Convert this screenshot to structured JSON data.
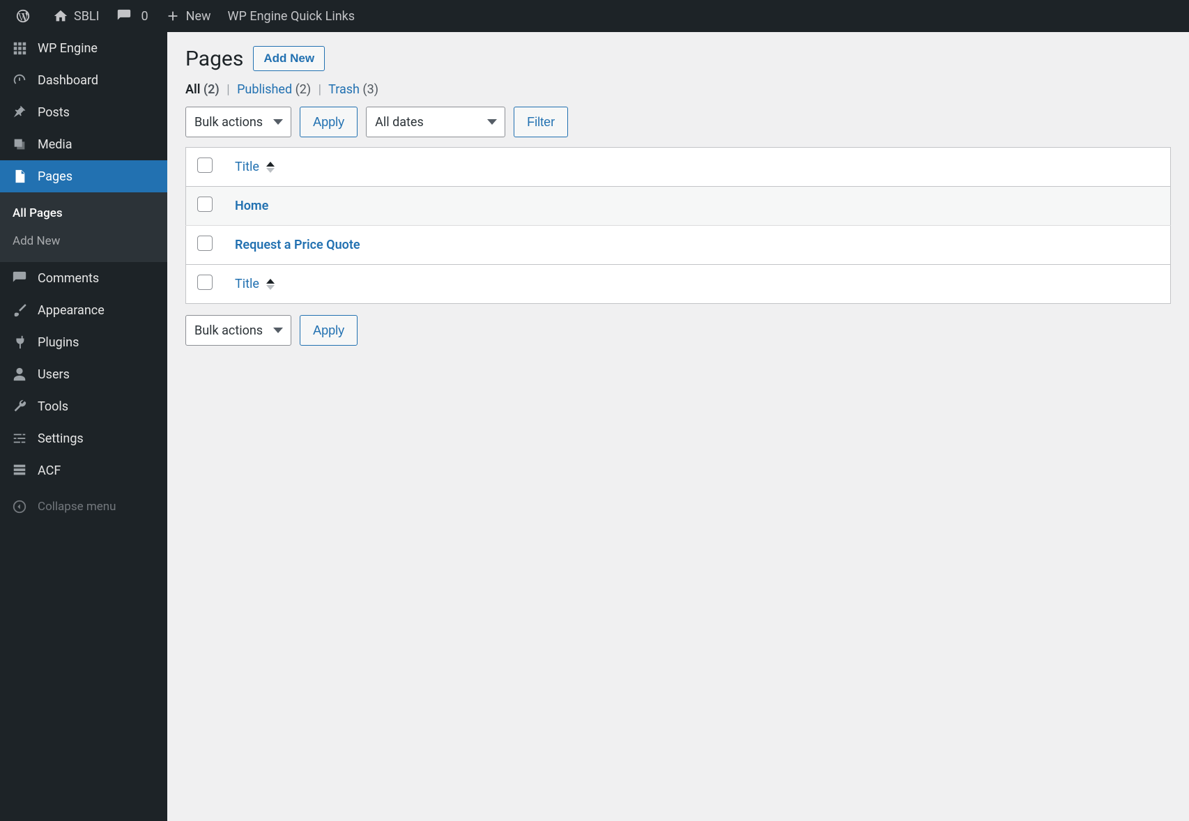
{
  "adminbar": {
    "site_name": "SBLI",
    "comments_count": "0",
    "new_label": "New",
    "quicklinks_label": "WP Engine Quick Links"
  },
  "sidebar": {
    "items": [
      {
        "label": "WP Engine"
      },
      {
        "label": "Dashboard"
      },
      {
        "label": "Posts"
      },
      {
        "label": "Media"
      },
      {
        "label": "Pages"
      },
      {
        "label": "Comments"
      },
      {
        "label": "Appearance"
      },
      {
        "label": "Plugins"
      },
      {
        "label": "Users"
      },
      {
        "label": "Tools"
      },
      {
        "label": "Settings"
      },
      {
        "label": "ACF"
      }
    ],
    "submenu_pages": {
      "all_pages": "All Pages",
      "add_new": "Add New"
    },
    "collapse_label": "Collapse menu"
  },
  "page": {
    "title": "Pages",
    "add_new_button": "Add New"
  },
  "filters": {
    "all_label": "All",
    "all_count": "(2)",
    "published_label": "Published",
    "published_count": "(2)",
    "trash_label": "Trash",
    "trash_count": "(3)"
  },
  "tablenav": {
    "bulk_actions_label": "Bulk actions",
    "apply_label": "Apply",
    "all_dates_label": "All dates",
    "filter_label": "Filter"
  },
  "table": {
    "title_header": "Title",
    "rows": [
      {
        "title": "Home"
      },
      {
        "title": "Request a Price Quote"
      }
    ]
  }
}
